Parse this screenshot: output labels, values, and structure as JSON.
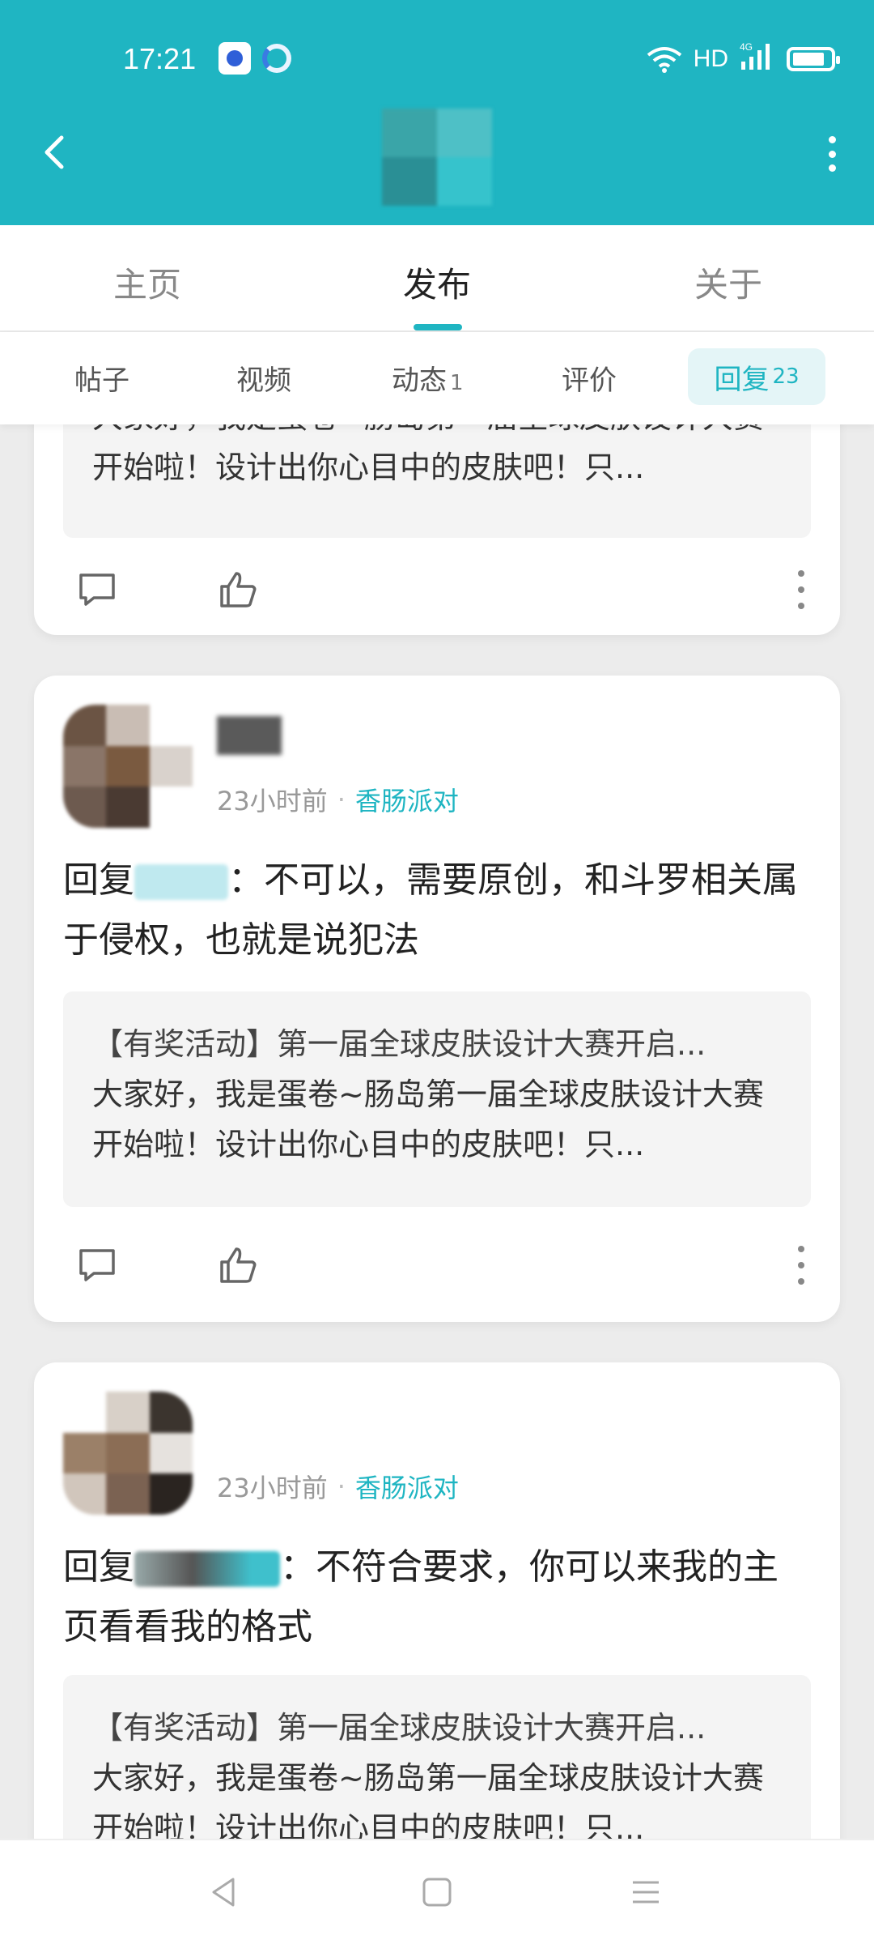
{
  "status_bar": {
    "time": "17:21",
    "network": "HD",
    "signal": "4G"
  },
  "header": {
    "back_icon": "chevron-left-icon",
    "more_icon": "more-vertical-icon"
  },
  "main_tabs": [
    {
      "label": "主页",
      "active": false
    },
    {
      "label": "发布",
      "active": true
    },
    {
      "label": "关于",
      "active": false
    }
  ],
  "sub_tabs": [
    {
      "label": "帖子",
      "count": ""
    },
    {
      "label": "视频",
      "count": ""
    },
    {
      "label": "动态",
      "count": "1"
    },
    {
      "label": "评价",
      "count": ""
    },
    {
      "label": "回复",
      "count": "23",
      "active": true
    }
  ],
  "cards": [
    {
      "quote_body": "大家好，我是蛋卷~肠岛第一届全球皮肤设计大赛开始啦！设计出你心目中的皮肤吧！只..."
    },
    {
      "time": "23小时前",
      "circle": "香肠派对",
      "reply_prefix": "回复",
      "reply_text": "：不可以，需要原创，和斗罗相关属于侵权，也就是说犯法",
      "quote_title": "【有奖活动】第一届全球皮肤设计大赛开启...",
      "quote_body": "大家好，我是蛋卷~肠岛第一届全球皮肤设计大赛开始啦！设计出你心目中的皮肤吧！只..."
    },
    {
      "time": "23小时前",
      "circle": "香肠派对",
      "reply_prefix": "回复",
      "reply_text": "：不符合要求，你可以来我的主页看看我的格式",
      "quote_title": "【有奖活动】第一届全球皮肤设计大赛开启...",
      "quote_body": "大家好，我是蛋卷~肠岛第一届全球皮肤设计大赛开始啦！设计出你心目中的皮肤吧！只..."
    }
  ],
  "meta_separator": "·",
  "colors": {
    "accent": "#1fb5c2",
    "background": "#ececec"
  }
}
